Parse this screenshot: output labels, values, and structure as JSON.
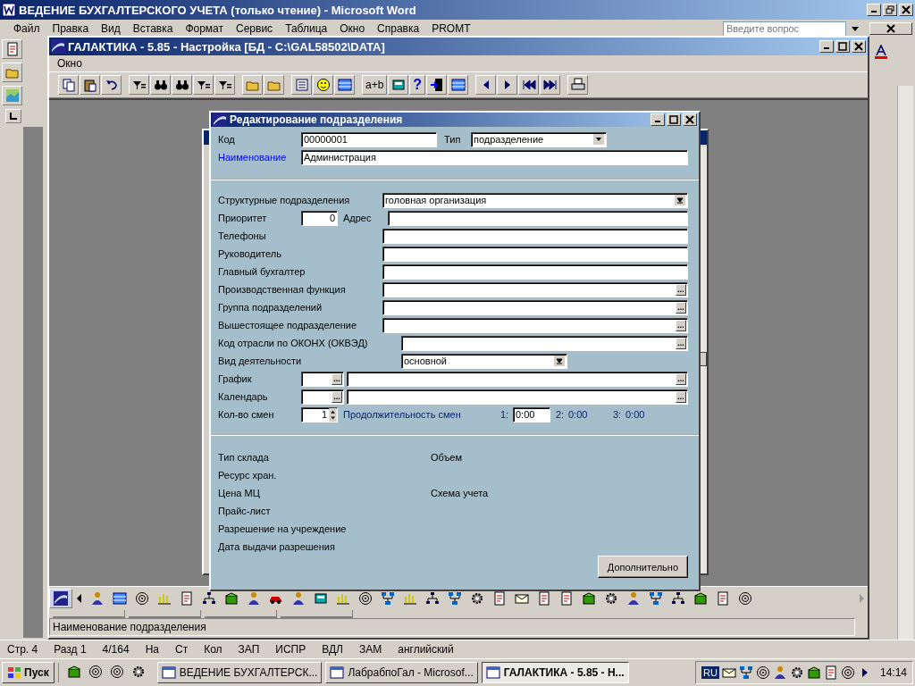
{
  "word": {
    "title": "ВЕДЕНИЕ БУХГАЛТЕРСКОГО УЧЕТА (только чтение) - Microsoft Word",
    "menu": [
      "Файл",
      "Правка",
      "Вид",
      "Вставка",
      "Формат",
      "Сервис",
      "Таблица",
      "Окно",
      "Справка",
      "PROMT"
    ],
    "help_search": {
      "placeholder": "Введите вопрос"
    },
    "status_bar": [
      "Стр. 4",
      "Разд 1",
      "4/164",
      "На",
      "Ст",
      "Кол",
      "ЗАП",
      "ИСПР",
      "ВДЛ",
      "ЗАМ",
      "английский"
    ]
  },
  "galaktika": {
    "title": "ГАЛАКТИКА - 5.85 - Настройка [БД - C:\\GAL58502\\DATA]",
    "menu": [
      "Окно"
    ],
    "calc_button": "a+b",
    "help_button": "?",
    "status": "Наименование подразделения"
  },
  "dialog": {
    "title": "Редактирование подразделения",
    "ellipsis": "...",
    "header": [
      {
        "kind": "code",
        "label": "Код",
        "value": "00000001",
        "label2": "Тип",
        "value2": "подразделение",
        "highlighted": false
      },
      {
        "kind": "text",
        "label": "Наименование",
        "value": "Администрация",
        "highlighted": true
      }
    ],
    "fields": [
      {
        "kind": "select",
        "label": "Структурные подразделения",
        "value": "головная организация"
      },
      {
        "kind": "pair",
        "label": "Приоритет",
        "value": "0",
        "label2": "Адрес"
      },
      {
        "kind": "text",
        "label": "Телефоны"
      },
      {
        "kind": "text",
        "label": "Руководитель"
      },
      {
        "kind": "text",
        "label": "Главный бухгалтер"
      },
      {
        "kind": "lookup",
        "label": "Производственная функция"
      },
      {
        "kind": "lookup",
        "label": "Группа подразделений"
      },
      {
        "kind": "lookup",
        "label": "Вышестоящее подразделение"
      },
      {
        "kind": "lookup-indented",
        "label": "Код отрасли по ОКОНХ (ОКВЭД)"
      },
      {
        "kind": "select-short",
        "label": "Вид деятельности",
        "value": "основной"
      },
      {
        "kind": "double-lookup",
        "label": "График"
      },
      {
        "kind": "double-lookup",
        "label": "Календарь"
      },
      {
        "kind": "shifts",
        "label": "Кол-во смен",
        "value": "1",
        "caption": "Продолжительность смен",
        "shifts": [
          {
            "label": "1:",
            "value": "0:00",
            "editable": true
          },
          {
            "label": "2:",
            "value": "0:00",
            "editable": false
          },
          {
            "label": "3:",
            "value": "0:00",
            "editable": false
          }
        ]
      }
    ],
    "info": [
      {
        "label": "Тип склада",
        "label2": "Объем"
      },
      {
        "label": "Ресурс хран."
      },
      {
        "label": "Цена МЦ",
        "label2": "Схема учета"
      },
      {
        "label": "Прайс-лист"
      },
      {
        "label": "Разрешение на учреждение"
      },
      {
        "label": "Дата выдачи разрешения"
      }
    ],
    "button": "Дополнительно"
  },
  "taskbar": {
    "start": "Пуск",
    "tasks": [
      {
        "label": "ВЕДЕНИЕ БУХГАЛТЕРСК...",
        "selected": false
      },
      {
        "label": "ЛабрабпоГал - Microsof...",
        "selected": false
      },
      {
        "label": "ГАЛАКТИКА - 5.85 - Н...",
        "selected": true
      }
    ],
    "language": "RU",
    "clock": "14:14"
  }
}
